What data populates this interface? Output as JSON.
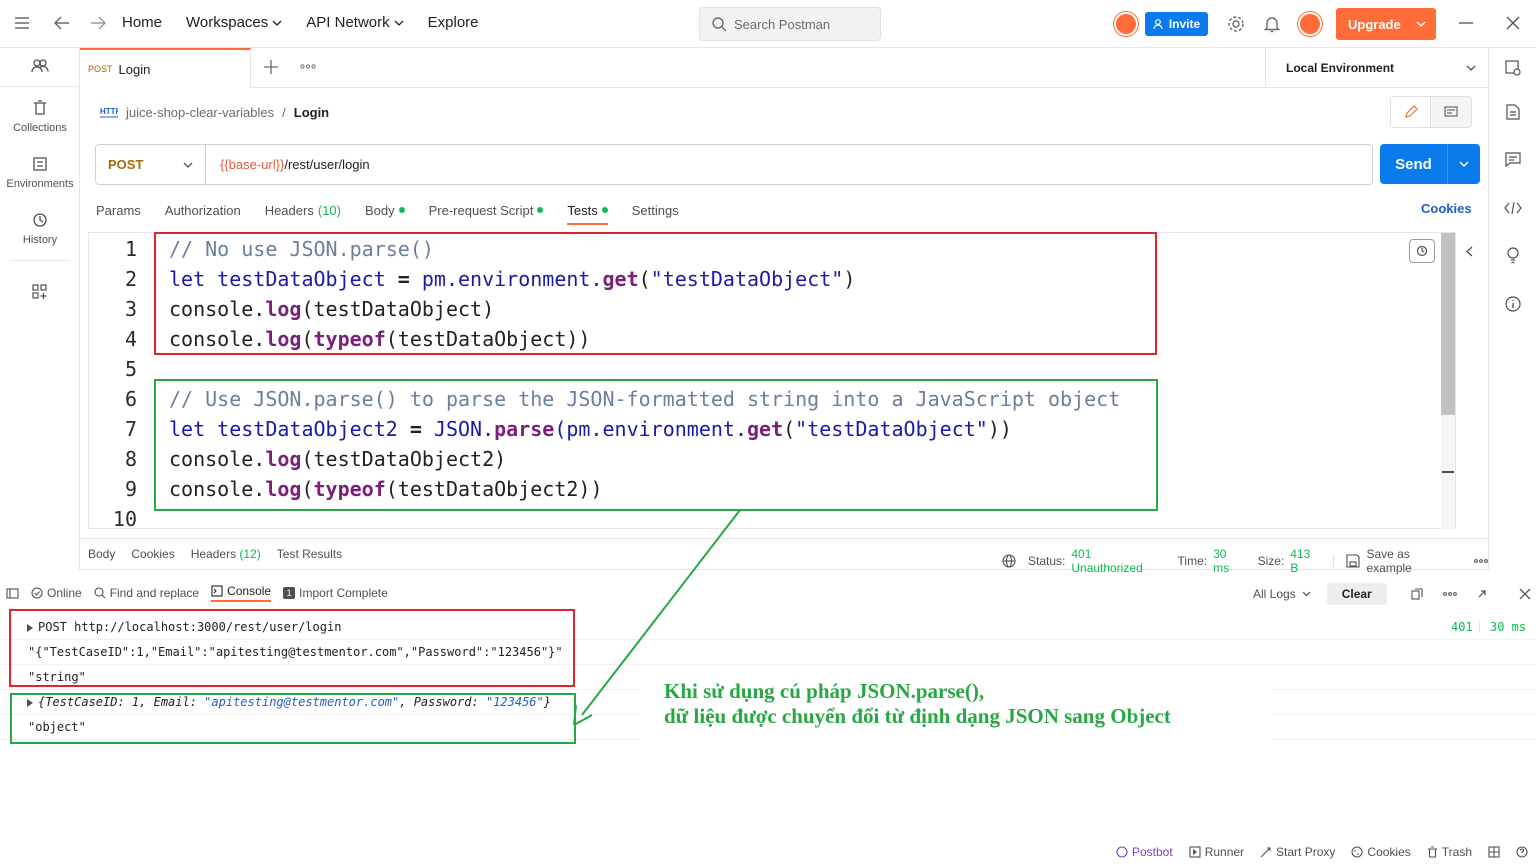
{
  "topbar": {
    "nav": [
      "Home",
      "Workspaces",
      "API Network",
      "Explore"
    ],
    "search_placeholder": "Search Postman",
    "invite_label": "Invite",
    "upgrade_label": "Upgrade"
  },
  "sidebar": {
    "items": [
      {
        "label": ""
      },
      {
        "label": "Collections"
      },
      {
        "label": "Environments"
      },
      {
        "label": "History"
      }
    ]
  },
  "tab": {
    "method": "POST",
    "name": "Login"
  },
  "environment": "Local Environment",
  "breadcrumb": {
    "collection": "juice-shop-clear-variables",
    "separator": "/",
    "request": "Login"
  },
  "request": {
    "method": "POST",
    "url_var": "{{base-url}}",
    "url_path": "/rest/user/login",
    "send_label": "Send",
    "tabs": [
      {
        "label": "Params"
      },
      {
        "label": "Authorization"
      },
      {
        "label": "Headers",
        "count": "(10)"
      },
      {
        "label": "Body"
      },
      {
        "label": "Pre-request Script"
      },
      {
        "label": "Tests"
      },
      {
        "label": "Settings"
      }
    ],
    "cookies_label": "Cookies"
  },
  "code": {
    "line_numbers": [
      "1",
      "2",
      "3",
      "4",
      "5",
      "6",
      "7",
      "8",
      "9",
      "10"
    ],
    "l1": "// No use JSON.parse()",
    "l2": {
      "kw": "let",
      "a": " testDataObject ",
      "eq": "=",
      "b": " pm.environment.",
      "fn": "get",
      "c": "(",
      "s": "\"testDataObject\"",
      "d": ")"
    },
    "l3": {
      "a": "console.",
      "fn": "log",
      "b": "(testDataObject)"
    },
    "l4": {
      "a": "console.",
      "fn": "log",
      "b": "(",
      "fn2": "typeof",
      "c": "(testDataObject))"
    },
    "l6": "// Use JSON.parse() to parse the JSON-formatted string into a JavaScript object",
    "l7": {
      "kw": "let",
      "a": " testDataObject2 ",
      "eq": "=",
      "b": " JSON.",
      "fn": "parse",
      "c": "(pm.environment.",
      "fn2": "get",
      "d": "(",
      "s": "\"testDataObject\"",
      "e": "))"
    },
    "l8": {
      "a": "console.",
      "fn": "log",
      "b": "(testDataObject2)"
    },
    "l9": {
      "a": "console.",
      "fn": "log",
      "b": "(",
      "fn2": "typeof",
      "c": "(testDataObject2))"
    }
  },
  "response": {
    "tabs": [
      {
        "label": "Body"
      },
      {
        "label": "Cookies"
      },
      {
        "label": "Headers",
        "count": "(12)"
      },
      {
        "label": "Test Results"
      }
    ],
    "status_label": "Status:",
    "status_value": "401 Unauthorized",
    "time_label": "Time:",
    "time_value": "30 ms",
    "size_label": "Size:",
    "size_value": "413 B",
    "save_label": "Save as example"
  },
  "consolebar": {
    "online": "Online",
    "find": "Find and replace",
    "console": "Console",
    "import": "Import Complete",
    "all_logs": "All Logs",
    "clear": "Clear"
  },
  "console": {
    "l1": "POST http://localhost:3000/rest/user/login",
    "l1_status": "401",
    "l1_time": "30 ms",
    "l2": "\"{\"TestCaseID\":1,\"Email\":\"apitesting@testmentor.com\",\"Password\":\"123456\"}\"",
    "l3": "\"string\"",
    "l4": {
      "a": "{TestCaseID: 1, Email: ",
      "email": "\"apitesting@testmentor.com\"",
      "b": ", Password: ",
      "pw": "\"123456\"",
      "c": "}"
    },
    "l5": "\"object\""
  },
  "annotation": {
    "line1": "Khi sử dụng cú pháp JSON.parse(),",
    "line2": "dữ liệu được chuyển đổi từ định dạng JSON sang Object"
  },
  "footer": [
    "Postbot",
    "Runner",
    "Start Proxy",
    "Cookies",
    "Trash"
  ],
  "colors": {
    "accent": "#ff6c37",
    "primary": "#097bed",
    "success": "#0cbb52",
    "red_box": "#e3232b",
    "green_box": "#27a844"
  }
}
